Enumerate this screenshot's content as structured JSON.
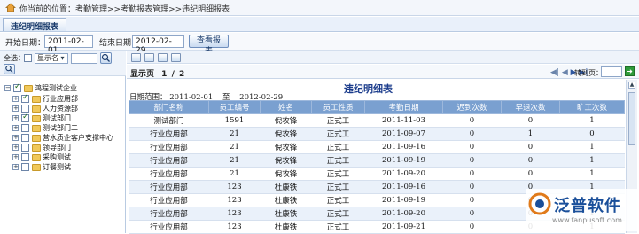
{
  "location": {
    "label": "你当前的位置：",
    "path": "考勤管理>>考勤报表管理>>违纪明细报表"
  },
  "title_tab": "违纪明细报表",
  "filter": {
    "start_label": "开始日期：",
    "start_value": "2011-02-01",
    "end_label": "结束日期：",
    "end_value": "2012-02-29",
    "query_button": "查看报表"
  },
  "left": {
    "select_all_label": "全选：",
    "show_name_option": "显示名",
    "search_icon": "search-icon",
    "tree": [
      {
        "label": "鸿程测试企业",
        "level": 0,
        "checked": true
      },
      {
        "label": "行业应用部",
        "level": 1,
        "checked": true
      },
      {
        "label": "人力资源部",
        "level": 1,
        "checked": false
      },
      {
        "label": "测试部门",
        "level": 1,
        "checked": true
      },
      {
        "label": "测试部门二",
        "level": 1,
        "checked": false
      },
      {
        "label": "营水质企客户支撑中心",
        "level": 1,
        "checked": false
      },
      {
        "label": "领导部门",
        "level": 1,
        "checked": false
      },
      {
        "label": "采购测试",
        "level": 1,
        "checked": false
      },
      {
        "label": "订餐测试",
        "level": 1,
        "checked": false
      }
    ]
  },
  "pager": {
    "label": "显示页",
    "current": "1",
    "sep": "/",
    "total": "2",
    "goto_label": "转到页："
  },
  "report": {
    "title": "违纪明细表",
    "range_label": "日期范围：",
    "range_start": "2011-02-01",
    "range_to": "至",
    "range_end": "2012-02-29",
    "columns": [
      "部门名称",
      "员工编号",
      "姓名",
      "员工性质",
      "考勤日期",
      "迟到次数",
      "早退次数",
      "旷工次数"
    ],
    "rows": [
      [
        "测试部门",
        "1591",
        "倪攻锋",
        "正式工",
        "2011-11-03",
        "0",
        "0",
        "1"
      ],
      [
        "行业应用部",
        "21",
        "倪攻锋",
        "正式工",
        "2011-09-07",
        "0",
        "1",
        "0"
      ],
      [
        "行业应用部",
        "21",
        "倪攻锋",
        "正式工",
        "2011-09-16",
        "0",
        "0",
        "1"
      ],
      [
        "行业应用部",
        "21",
        "倪攻锋",
        "正式工",
        "2011-09-19",
        "0",
        "0",
        "1"
      ],
      [
        "行业应用部",
        "21",
        "倪攻锋",
        "正式工",
        "2011-09-20",
        "0",
        "0",
        "1"
      ],
      [
        "行业应用部",
        "123",
        "杜康铁",
        "正式工",
        "2011-09-16",
        "0",
        "0",
        "1"
      ],
      [
        "行业应用部",
        "123",
        "杜康铁",
        "正式工",
        "2011-09-19",
        "0",
        "0",
        "1"
      ],
      [
        "行业应用部",
        "123",
        "杜康铁",
        "正式工",
        "2011-09-20",
        "0",
        "0",
        "1"
      ],
      [
        "行业应用部",
        "123",
        "杜康铁",
        "正式工",
        "2011-09-21",
        "0",
        "0",
        "1"
      ]
    ]
  },
  "watermark": {
    "name": "泛普软件",
    "url": "www.fanpusoft.com"
  },
  "colors": {
    "header_bg": "#7aa0d0",
    "title_blue": "#1a3b8b",
    "go_green": "#2e9b3a"
  }
}
